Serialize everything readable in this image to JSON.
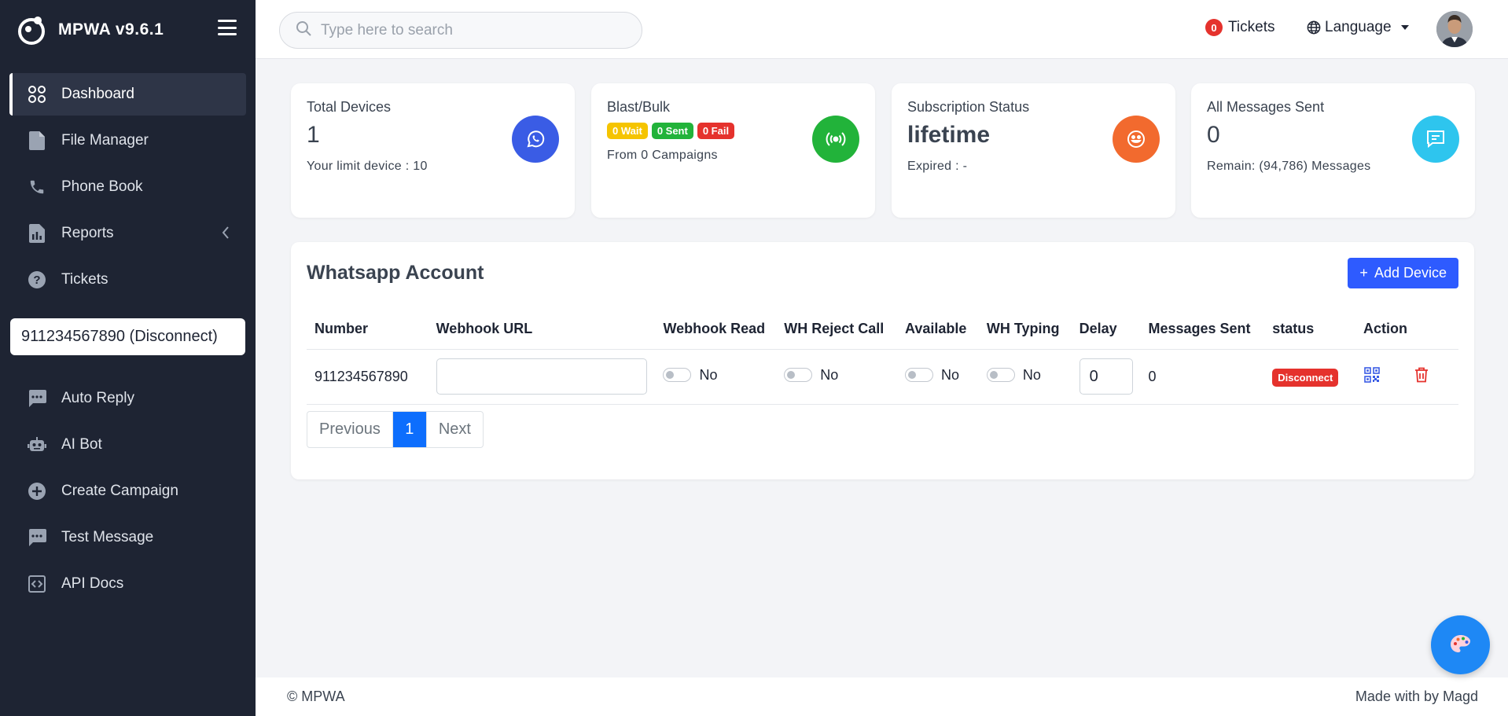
{
  "app": {
    "brand": "MPWA v9.6.1"
  },
  "search": {
    "placeholder": "Type here to search"
  },
  "topbar": {
    "tickets_count": "0",
    "tickets_label": "Tickets",
    "language_label": "Language"
  },
  "sidebar": {
    "items": [
      {
        "label": "Dashboard",
        "icon": "dashboard-icon",
        "active": true
      },
      {
        "label": "File Manager",
        "icon": "file-icon"
      },
      {
        "label": "Phone Book",
        "icon": "phone-icon"
      },
      {
        "label": "Reports",
        "icon": "reports-icon"
      },
      {
        "label": "Tickets",
        "icon": "question-icon"
      }
    ],
    "device_select": "911234567890 (Disconnect)",
    "items2": [
      {
        "label": "Auto Reply",
        "icon": "chat-icon"
      },
      {
        "label": "AI Bot",
        "icon": "robot-icon"
      },
      {
        "label": "Create Campaign",
        "icon": "plus-circle-icon"
      },
      {
        "label": "Test Message",
        "icon": "chat-icon"
      },
      {
        "label": "API Docs",
        "icon": "code-icon"
      }
    ]
  },
  "stats": {
    "devices": {
      "title": "Total Devices",
      "value": "1",
      "sub": "Your limit device : 10",
      "icon": "whatsapp-icon",
      "color": "#3a5ce5"
    },
    "blast": {
      "title": "Blast/Bulk",
      "wait": "0 Wait",
      "sent": "0 Sent",
      "fail": "0 Fail",
      "sub": "From 0 Campaigns",
      "icon": "broadcast-icon",
      "color": "#22b33a"
    },
    "subscription": {
      "title": "Subscription Status",
      "value": "lifetime",
      "sub": "Expired : -",
      "icon": "smile-icon",
      "color": "#f26a2e"
    },
    "messages": {
      "title": "All Messages Sent",
      "value": "0",
      "sub": "Remain: (94,786) Messages",
      "icon": "message-icon",
      "color": "#2ec5ee"
    }
  },
  "account": {
    "title": "Whatsapp Account",
    "add_button": "Add Device",
    "columns": [
      "Number",
      "Webhook URL",
      "Webhook Read",
      "WH Reject Call",
      "Available",
      "WH Typing",
      "Delay",
      "Messages Sent",
      "status",
      "Action"
    ],
    "row": {
      "number": "911234567890",
      "webhook_url": "",
      "webhook_read": "No",
      "reject_call": "No",
      "available": "No",
      "typing": "No",
      "delay": "0",
      "messages_sent": "0",
      "status": "Disconnect"
    },
    "pagination": {
      "prev": "Previous",
      "page": "1",
      "next": "Next"
    }
  },
  "footer": {
    "left": "© MPWA",
    "right": "Made with by Magd"
  }
}
